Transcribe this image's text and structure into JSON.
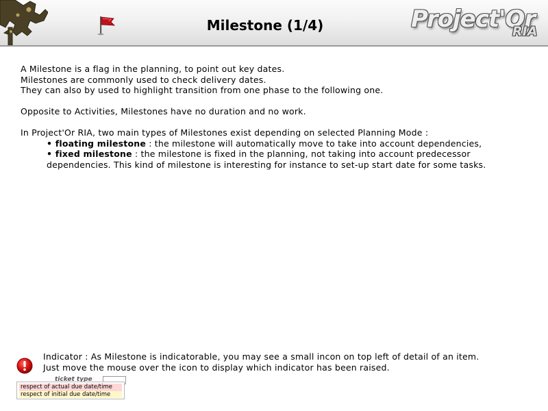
{
  "header": {
    "title": "Milestone (1/4)",
    "brand_main": "Project'Or",
    "brand_sub": "RIA"
  },
  "content": {
    "p1_line1": "A Milestone is a flag in the planning, to point out key dates.",
    "p1_line2": "Milestones are commonly used to check delivery dates.",
    "p1_line3": "They can also by used to highlight transition from one phase to the following one.",
    "p2": "Opposite to Activities, Milestones have no duration and no work.",
    "p3_intro": "In Project'Or RIA, two main types of Milestones exist depending on selected Planning Mode :",
    "bullets": [
      {
        "term": "floating milestone",
        "text": " : the milestone will automatically move to take into account dependencies,"
      },
      {
        "term": "fixed milestone",
        "text": " : the milestone is fixed in the planning, not taking into account predecessor dependencies. This kind of milestone is interesting for instance to set-up start date for some tasks."
      }
    ]
  },
  "indicator": {
    "line1": "Indicator : As Milestone is indicatorable, you may see a small incon on top left of detail of an item.",
    "line2": "Just move the mouse over the icon to display which indicator has been raised.",
    "bg_label": "ticket type",
    "tooltip_lines": [
      "respect of actual due date/time",
      "respect of initial due date/time"
    ]
  },
  "colors": {
    "indicator_red": "#d81010",
    "flag_red": "#c0141c",
    "tooltip_red_bg": "#ffd6d6",
    "tooltip_yellow_bg": "#fff7c8"
  },
  "icons": {
    "header_left": "tower-crane-logo",
    "title": "flag-icon",
    "indicator": "exclamation-icon"
  }
}
